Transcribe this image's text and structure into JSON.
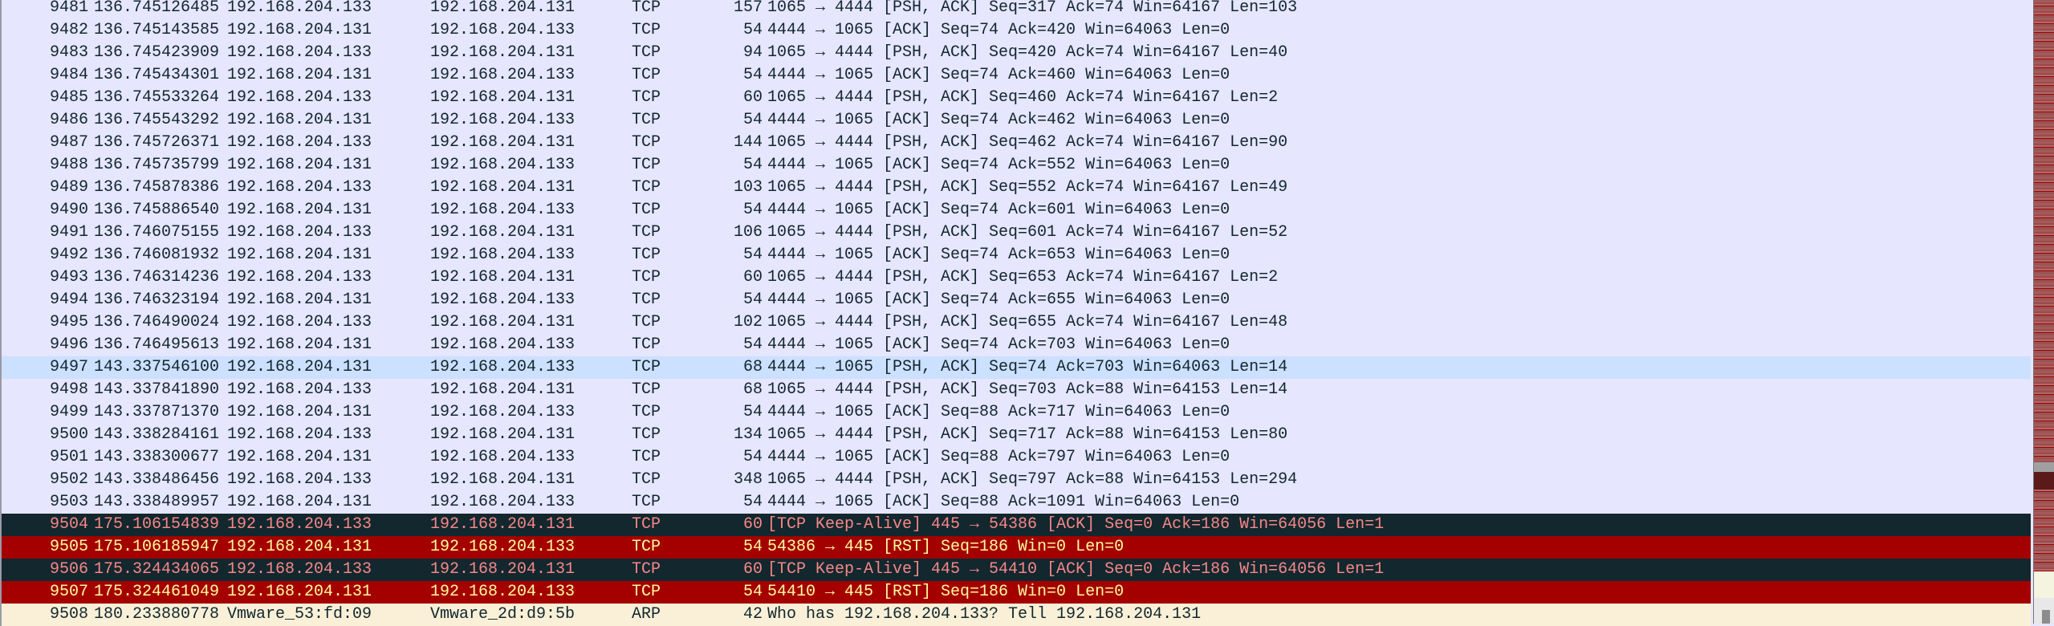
{
  "colors": {
    "background": "#e6e6fe",
    "selected": "#cce0ff",
    "dark_bg": "#12272e",
    "dark_fg": "#f78787",
    "rst_bg": "#a40000",
    "rst_fg": "#fffc9c",
    "arp_bg": "#faf0d7"
  },
  "selected_packet": "9497",
  "packets": [
    {
      "no": "9481",
      "time": "136.745126485",
      "src": "192.168.204.133",
      "dst": "192.168.204.131",
      "proto": "TCP",
      "len": "157",
      "info": "1065 → 4444 [PSH, ACK] Seq=317 Ack=74 Win=64167 Len=103",
      "style": ""
    },
    {
      "no": "9482",
      "time": "136.745143585",
      "src": "192.168.204.131",
      "dst": "192.168.204.133",
      "proto": "TCP",
      "len": "54",
      "info": "4444 → 1065 [ACK] Seq=74 Ack=420 Win=64063 Len=0",
      "style": ""
    },
    {
      "no": "9483",
      "time": "136.745423909",
      "src": "192.168.204.133",
      "dst": "192.168.204.131",
      "proto": "TCP",
      "len": "94",
      "info": "1065 → 4444 [PSH, ACK] Seq=420 Ack=74 Win=64167 Len=40",
      "style": ""
    },
    {
      "no": "9484",
      "time": "136.745434301",
      "src": "192.168.204.131",
      "dst": "192.168.204.133",
      "proto": "TCP",
      "len": "54",
      "info": "4444 → 1065 [ACK] Seq=74 Ack=460 Win=64063 Len=0",
      "style": ""
    },
    {
      "no": "9485",
      "time": "136.745533264",
      "src": "192.168.204.133",
      "dst": "192.168.204.131",
      "proto": "TCP",
      "len": "60",
      "info": "1065 → 4444 [PSH, ACK] Seq=460 Ack=74 Win=64167 Len=2",
      "style": ""
    },
    {
      "no": "9486",
      "time": "136.745543292",
      "src": "192.168.204.131",
      "dst": "192.168.204.133",
      "proto": "TCP",
      "len": "54",
      "info": "4444 → 1065 [ACK] Seq=74 Ack=462 Win=64063 Len=0",
      "style": ""
    },
    {
      "no": "9487",
      "time": "136.745726371",
      "src": "192.168.204.133",
      "dst": "192.168.204.131",
      "proto": "TCP",
      "len": "144",
      "info": "1065 → 4444 [PSH, ACK] Seq=462 Ack=74 Win=64167 Len=90",
      "style": ""
    },
    {
      "no": "9488",
      "time": "136.745735799",
      "src": "192.168.204.131",
      "dst": "192.168.204.133",
      "proto": "TCP",
      "len": "54",
      "info": "4444 → 1065 [ACK] Seq=74 Ack=552 Win=64063 Len=0",
      "style": ""
    },
    {
      "no": "9489",
      "time": "136.745878386",
      "src": "192.168.204.133",
      "dst": "192.168.204.131",
      "proto": "TCP",
      "len": "103",
      "info": "1065 → 4444 [PSH, ACK] Seq=552 Ack=74 Win=64167 Len=49",
      "style": ""
    },
    {
      "no": "9490",
      "time": "136.745886540",
      "src": "192.168.204.131",
      "dst": "192.168.204.133",
      "proto": "TCP",
      "len": "54",
      "info": "4444 → 1065 [ACK] Seq=74 Ack=601 Win=64063 Len=0",
      "style": ""
    },
    {
      "no": "9491",
      "time": "136.746075155",
      "src": "192.168.204.133",
      "dst": "192.168.204.131",
      "proto": "TCP",
      "len": "106",
      "info": "1065 → 4444 [PSH, ACK] Seq=601 Ack=74 Win=64167 Len=52",
      "style": ""
    },
    {
      "no": "9492",
      "time": "136.746081932",
      "src": "192.168.204.131",
      "dst": "192.168.204.133",
      "proto": "TCP",
      "len": "54",
      "info": "4444 → 1065 [ACK] Seq=74 Ack=653 Win=64063 Len=0",
      "style": ""
    },
    {
      "no": "9493",
      "time": "136.746314236",
      "src": "192.168.204.133",
      "dst": "192.168.204.131",
      "proto": "TCP",
      "len": "60",
      "info": "1065 → 4444 [PSH, ACK] Seq=653 Ack=74 Win=64167 Len=2",
      "style": ""
    },
    {
      "no": "9494",
      "time": "136.746323194",
      "src": "192.168.204.131",
      "dst": "192.168.204.133",
      "proto": "TCP",
      "len": "54",
      "info": "4444 → 1065 [ACK] Seq=74 Ack=655 Win=64063 Len=0",
      "style": ""
    },
    {
      "no": "9495",
      "time": "136.746490024",
      "src": "192.168.204.133",
      "dst": "192.168.204.131",
      "proto": "TCP",
      "len": "102",
      "info": "1065 → 4444 [PSH, ACK] Seq=655 Ack=74 Win=64167 Len=48",
      "style": ""
    },
    {
      "no": "9496",
      "time": "136.746495613",
      "src": "192.168.204.131",
      "dst": "192.168.204.133",
      "proto": "TCP",
      "len": "54",
      "info": "4444 → 1065 [ACK] Seq=74 Ack=703 Win=64063 Len=0",
      "style": ""
    },
    {
      "no": "9497",
      "time": "143.337546100",
      "src": "192.168.204.131",
      "dst": "192.168.204.133",
      "proto": "TCP",
      "len": "68",
      "info": "4444 → 1065 [PSH, ACK] Seq=74 Ack=703 Win=64063 Len=14",
      "style": "sel"
    },
    {
      "no": "9498",
      "time": "143.337841890",
      "src": "192.168.204.133",
      "dst": "192.168.204.131",
      "proto": "TCP",
      "len": "68",
      "info": "1065 → 4444 [PSH, ACK] Seq=703 Ack=88 Win=64153 Len=14",
      "style": ""
    },
    {
      "no": "9499",
      "time": "143.337871370",
      "src": "192.168.204.131",
      "dst": "192.168.204.133",
      "proto": "TCP",
      "len": "54",
      "info": "4444 → 1065 [ACK] Seq=88 Ack=717 Win=64063 Len=0",
      "style": ""
    },
    {
      "no": "9500",
      "time": "143.338284161",
      "src": "192.168.204.133",
      "dst": "192.168.204.131",
      "proto": "TCP",
      "len": "134",
      "info": "1065 → 4444 [PSH, ACK] Seq=717 Ack=88 Win=64153 Len=80",
      "style": ""
    },
    {
      "no": "9501",
      "time": "143.338300677",
      "src": "192.168.204.131",
      "dst": "192.168.204.133",
      "proto": "TCP",
      "len": "54",
      "info": "4444 → 1065 [ACK] Seq=88 Ack=797 Win=64063 Len=0",
      "style": ""
    },
    {
      "no": "9502",
      "time": "143.338486456",
      "src": "192.168.204.133",
      "dst": "192.168.204.131",
      "proto": "TCP",
      "len": "348",
      "info": "1065 → 4444 [PSH, ACK] Seq=797 Ack=88 Win=64153 Len=294",
      "style": ""
    },
    {
      "no": "9503",
      "time": "143.338489957",
      "src": "192.168.204.131",
      "dst": "192.168.204.133",
      "proto": "TCP",
      "len": "54",
      "info": "4444 → 1065 [ACK] Seq=88 Ack=1091 Win=64063 Len=0",
      "style": ""
    },
    {
      "no": "9504",
      "time": "175.106154839",
      "src": "192.168.204.133",
      "dst": "192.168.204.131",
      "proto": "TCP",
      "len": "60",
      "info": "[TCP Keep-Alive] 445 → 54386 [ACK] Seq=0 Ack=186 Win=64056 Len=1",
      "style": "dark"
    },
    {
      "no": "9505",
      "time": "175.106185947",
      "src": "192.168.204.131",
      "dst": "192.168.204.133",
      "proto": "TCP",
      "len": "54",
      "info": "54386 → 445 [RST] Seq=186 Win=0 Len=0",
      "style": "rst"
    },
    {
      "no": "9506",
      "time": "175.324434065",
      "src": "192.168.204.133",
      "dst": "192.168.204.131",
      "proto": "TCP",
      "len": "60",
      "info": "[TCP Keep-Alive] 445 → 54410 [ACK] Seq=0 Ack=186 Win=64056 Len=1",
      "style": "dark"
    },
    {
      "no": "9507",
      "time": "175.324461049",
      "src": "192.168.204.131",
      "dst": "192.168.204.133",
      "proto": "TCP",
      "len": "54",
      "info": "54410 → 445 [RST] Seq=186 Win=0 Len=0",
      "style": "rst"
    },
    {
      "no": "9508",
      "time": "180.233880778",
      "src": "Vmware_53:fd:09",
      "dst": "Vmware_2d:d9:5b",
      "proto": "ARP",
      "len": "42",
      "info": "Who has 192.168.204.133? Tell 192.168.204.131",
      "style": "arp"
    }
  ]
}
